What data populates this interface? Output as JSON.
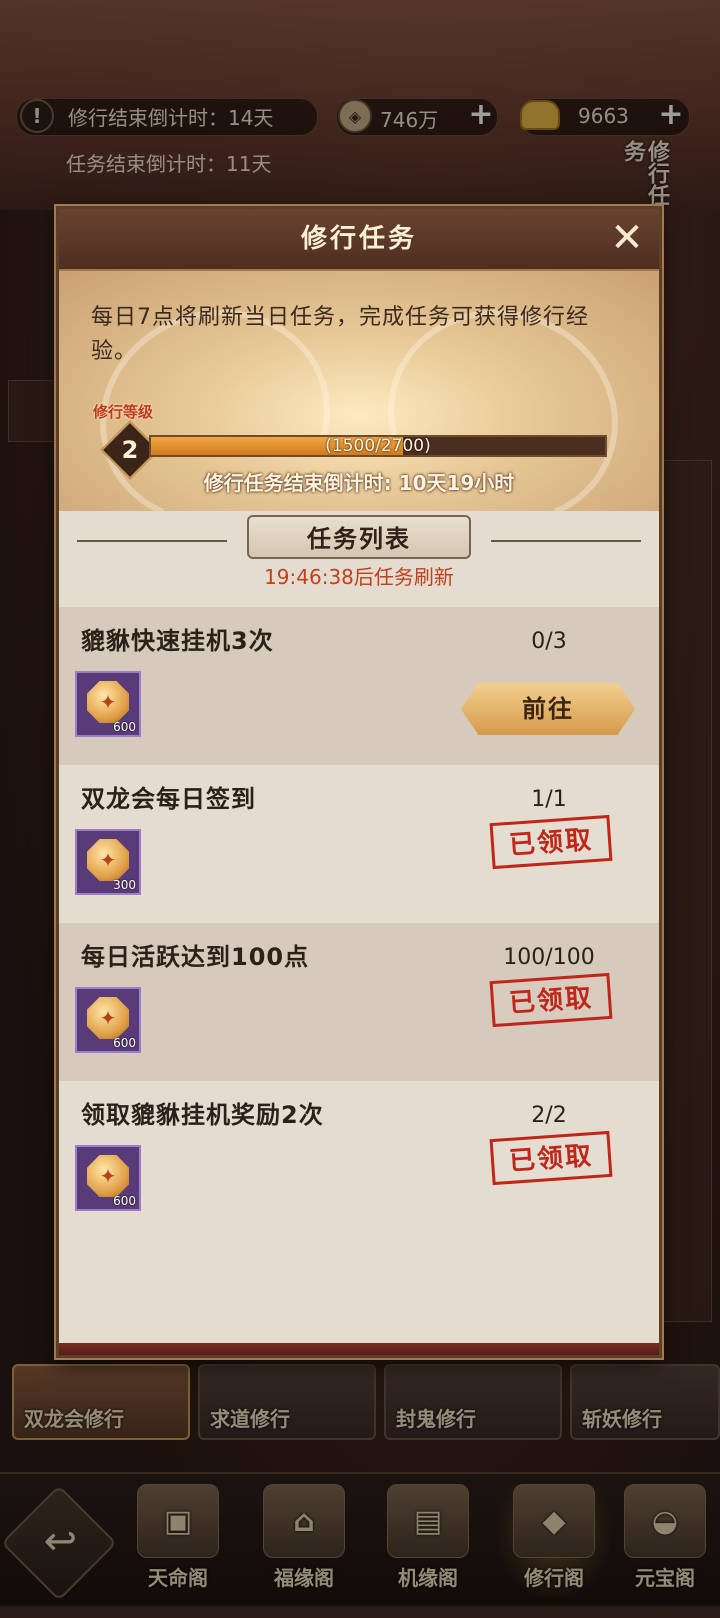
{
  "hud": {
    "cultivation_countdown": "修行结束倒计时：14天",
    "coins": "746万",
    "ingots": "9663",
    "task_countdown": "任务结束倒计时：11天",
    "side_label": "修行任务"
  },
  "modal": {
    "title": "修行任务",
    "close_symbol": "✕",
    "description": "每日7点将刷新当日任务，完成任务可获得修行经验。",
    "level_label": "修行等级",
    "level": "2",
    "exp_current": 1500,
    "exp_max": 2700,
    "exp_text": "(1500/2700)",
    "countdown": "修行任务结束倒计时: 10天19小时",
    "list_title": "任务列表",
    "refresh_text": "19:46:38后任务刷新",
    "go_label": "前往",
    "claimed_label": "已领取",
    "tasks": [
      {
        "name": "貔貅快速挂机3次",
        "progress": "0/3",
        "reward": "600",
        "status": "go"
      },
      {
        "name": "双龙会每日签到",
        "progress": "1/1",
        "reward": "300",
        "status": "claimed"
      },
      {
        "name": "每日活跃达到100点",
        "progress": "100/100",
        "reward": "600",
        "status": "claimed"
      },
      {
        "name": "领取貔貅挂机奖励2次",
        "progress": "2/2",
        "reward": "600",
        "status": "claimed"
      }
    ]
  },
  "mode_tabs": [
    {
      "label": "双龙会修行",
      "active": true
    },
    {
      "label": "求道修行",
      "active": false
    },
    {
      "label": "封鬼修行",
      "active": false
    },
    {
      "label": "斩妖修行",
      "active": false
    }
  ],
  "bottom_nav": [
    {
      "label": "天命阁",
      "icon": "chest-icon"
    },
    {
      "label": "福缘阁",
      "icon": "shrine-icon"
    },
    {
      "label": "机缘阁",
      "icon": "card-icon"
    },
    {
      "label": "修行阁",
      "icon": "token-icon",
      "active": true
    },
    {
      "label": "元宝阁",
      "icon": "ingot-icon"
    }
  ],
  "colors": {
    "accent_red": "#c0271b",
    "progress_orange": "#e08a2a",
    "panel_bg": "#e3dccf"
  }
}
